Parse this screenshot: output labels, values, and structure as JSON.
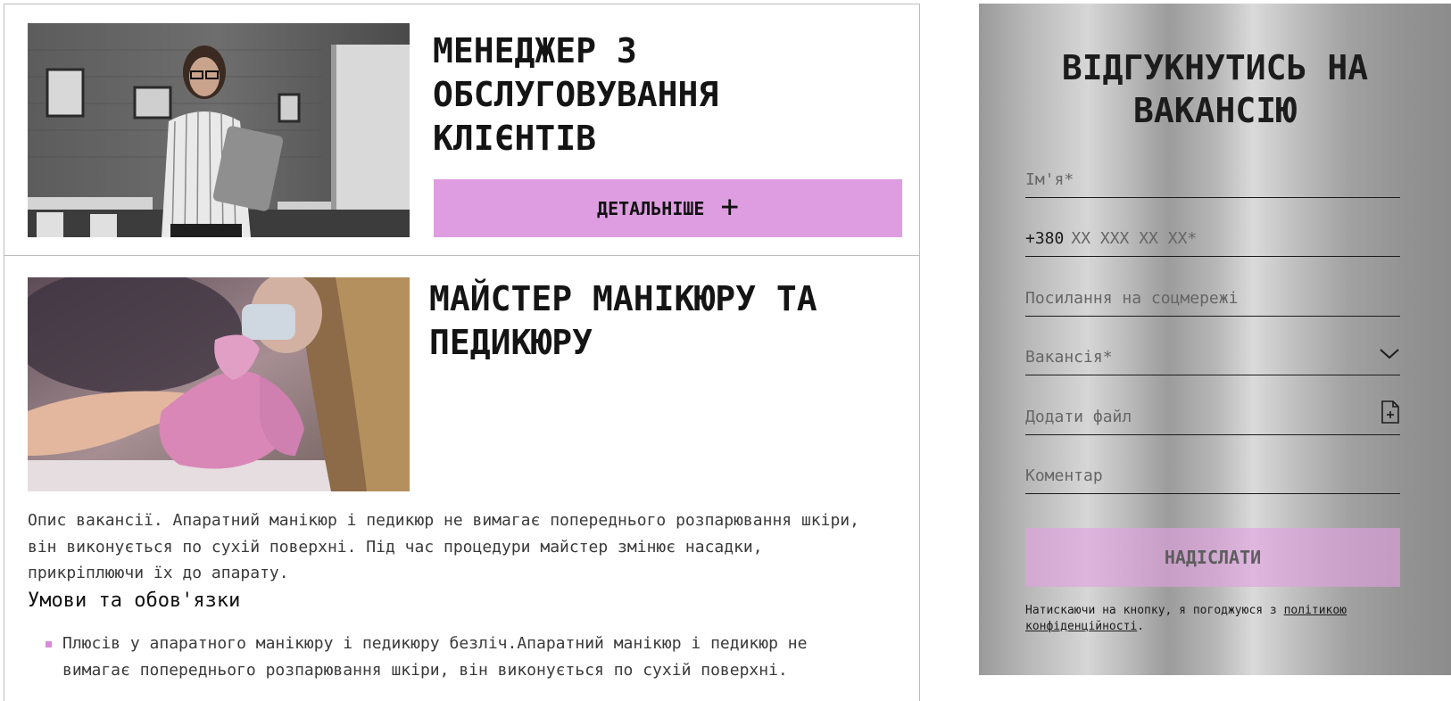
{
  "jobs": [
    {
      "title": "МЕНЕДЖЕР З ОБСЛУГОВУВАННЯ КЛІЄНТІВ",
      "button_label": "ДЕТАЛЬНІШЕ",
      "button_icon": "plus-icon"
    },
    {
      "title": "МАЙСТЕР МАНІКЮРУ ТА ПЕДИКЮРУ",
      "description": "Опис вакансії. Апаратний манікюр і педикюр не вимагає попереднього розпарювання шкіри, він виконується по сухій поверхні. Під час процедури майстер змінює насадки, прикріплюючи їх до апарату.",
      "conditions_heading": "Умови та обов'язки",
      "conditions": [
        "Плюсів у апаратного манікюру і педикюру безліч.Апаратний манікюр і педикюр не вимагає попереднього розпарювання шкіри, він виконується по сухій поверхні."
      ]
    }
  ],
  "form": {
    "title": "ВІДГУКНУТИСЬ НА ВАКАНСІЮ",
    "name_placeholder": "Ім'я*",
    "phone_prefix": "+380",
    "phone_placeholder": "XX XXX XX XX*",
    "social_placeholder": "Посилання на соцмережі",
    "vacancy_placeholder": "Вакансія*",
    "file_placeholder": "Додати файл",
    "comment_placeholder": "Коментар",
    "submit_label": "НАДІСЛАТИ",
    "consent_text": "Натискаючи на кнопку, я погоджуюся з ",
    "consent_link": "політикою конфіденційності",
    "consent_end": "."
  },
  "colors": {
    "accent": "#dd9de0",
    "bullet": "#d98bd8",
    "border": "#bdbdbd"
  }
}
